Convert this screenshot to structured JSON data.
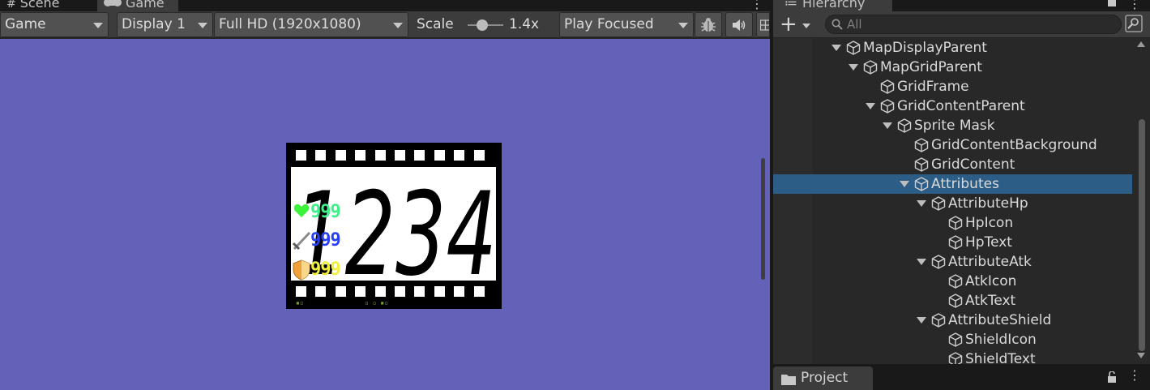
{
  "game_panel": {
    "tabs": [
      {
        "label": "Scene",
        "icon": "hash-icon"
      },
      {
        "label": "Game",
        "icon": "gamepad-icon"
      }
    ],
    "toolbar": {
      "display_mode": "Game",
      "display": "Display 1",
      "resolution": "Full HD (1920x1080)",
      "scale_label": "Scale",
      "scale_value": "1.4x",
      "play_mode": "Play Focused"
    },
    "view_background": "#6461b9",
    "card": {
      "big_text": "1234",
      "stats": [
        {
          "icon": "heart-icon",
          "value": "999",
          "color": "#3ff08a"
        },
        {
          "icon": "sword-icon",
          "value": "999",
          "color": "#2a3ff0"
        },
        {
          "icon": "shield-icon",
          "value": "999",
          "color": "#f2f03c"
        }
      ]
    }
  },
  "hierarchy": {
    "tab_label": "Hierarchy",
    "search_placeholder": "All",
    "items": [
      {
        "label": "MapDisplayParent",
        "depth": 0,
        "expanded": true
      },
      {
        "label": "MapGridParent",
        "depth": 1,
        "expanded": true
      },
      {
        "label": "GridFrame",
        "depth": 2,
        "expanded": null
      },
      {
        "label": "GridContentParent",
        "depth": 2,
        "expanded": true
      },
      {
        "label": "Sprite Mask",
        "depth": 3,
        "expanded": true
      },
      {
        "label": "GridContentBackground",
        "depth": 4,
        "expanded": null
      },
      {
        "label": "GridContent",
        "depth": 4,
        "expanded": null
      },
      {
        "label": "Attributes",
        "depth": 4,
        "expanded": true,
        "selected": true
      },
      {
        "label": "AttributeHp",
        "depth": 5,
        "expanded": true
      },
      {
        "label": "HpIcon",
        "depth": 6,
        "expanded": null
      },
      {
        "label": "HpText",
        "depth": 6,
        "expanded": null
      },
      {
        "label": "AttributeAtk",
        "depth": 5,
        "expanded": true
      },
      {
        "label": "AtkIcon",
        "depth": 6,
        "expanded": null
      },
      {
        "label": "AtkText",
        "depth": 6,
        "expanded": null
      },
      {
        "label": "AttributeShield",
        "depth": 5,
        "expanded": true
      },
      {
        "label": "ShieldIcon",
        "depth": 6,
        "expanded": null
      },
      {
        "label": "ShieldText",
        "depth": 6,
        "expanded": null
      }
    ]
  },
  "project": {
    "tab_label": "Project"
  }
}
